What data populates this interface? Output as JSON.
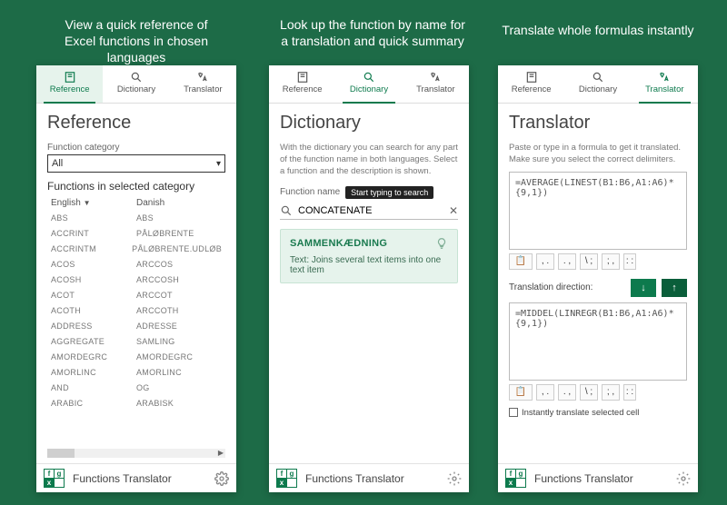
{
  "captions": {
    "c1a": "View a quick reference of",
    "c1b": "Excel functions in chosen languages",
    "c2a": "Look up the function by name for",
    "c2b": "a translation and quick summary",
    "c3": "Translate whole formulas instantly"
  },
  "tabs": {
    "reference": "Reference",
    "dictionary": "Dictionary",
    "translator": "Translator"
  },
  "footer": {
    "title": "Functions Translator"
  },
  "panel1": {
    "title": "Reference",
    "category_label": "Function category",
    "category_value": "All",
    "list_title": "Functions in selected category",
    "col1": "English",
    "col2": "Danish",
    "rows": [
      [
        "ABS",
        "ABS"
      ],
      [
        "ACCRINT",
        "PÅLØBRENTE"
      ],
      [
        "ACCRINTM",
        "PÅLØBRENTE.UDLØB"
      ],
      [
        "ACOS",
        "ARCCOS"
      ],
      [
        "ACOSH",
        "ARCCOSH"
      ],
      [
        "ACOT",
        "ARCCOT"
      ],
      [
        "ACOTH",
        "ARCCOTH"
      ],
      [
        "ADDRESS",
        "ADRESSE"
      ],
      [
        "AGGREGATE",
        "SAMLING"
      ],
      [
        "AMORDEGRC",
        "AMORDEGRC"
      ],
      [
        "AMORLINC",
        "AMORLINC"
      ],
      [
        "AND",
        "OG"
      ],
      [
        "ARABIC",
        "ARABISK"
      ]
    ]
  },
  "panel2": {
    "title": "Dictionary",
    "desc": "With the dictionary you can search for any part of the function name in both languages. Select a function and the description is shown.",
    "fname_label": "Function name",
    "tooltip": "Start typing to search",
    "search_value": "CONCATENATE",
    "result_name": "SAMMENKÆDNING",
    "result_desc": "Text: Joins several text items into one text item"
  },
  "panel3": {
    "title": "Translator",
    "hint": "Paste or type in a formula to get it translated. Make sure you select the correct delimiters.",
    "input_formula": "=AVERAGE(LINEST(B1:B6,A1:A6)*{9,1})",
    "direction_label": "Translation direction:",
    "output_formula": "=MIDDEL(LINREGR(B1:B6,A1:A6)*{9,1})",
    "instant_label": "Instantly translate selected cell",
    "delims": {
      "a1": ", .",
      "a2": ". ,",
      "a3": "\\  ;",
      "a4": ";  ,",
      "a5": ": :"
    }
  }
}
